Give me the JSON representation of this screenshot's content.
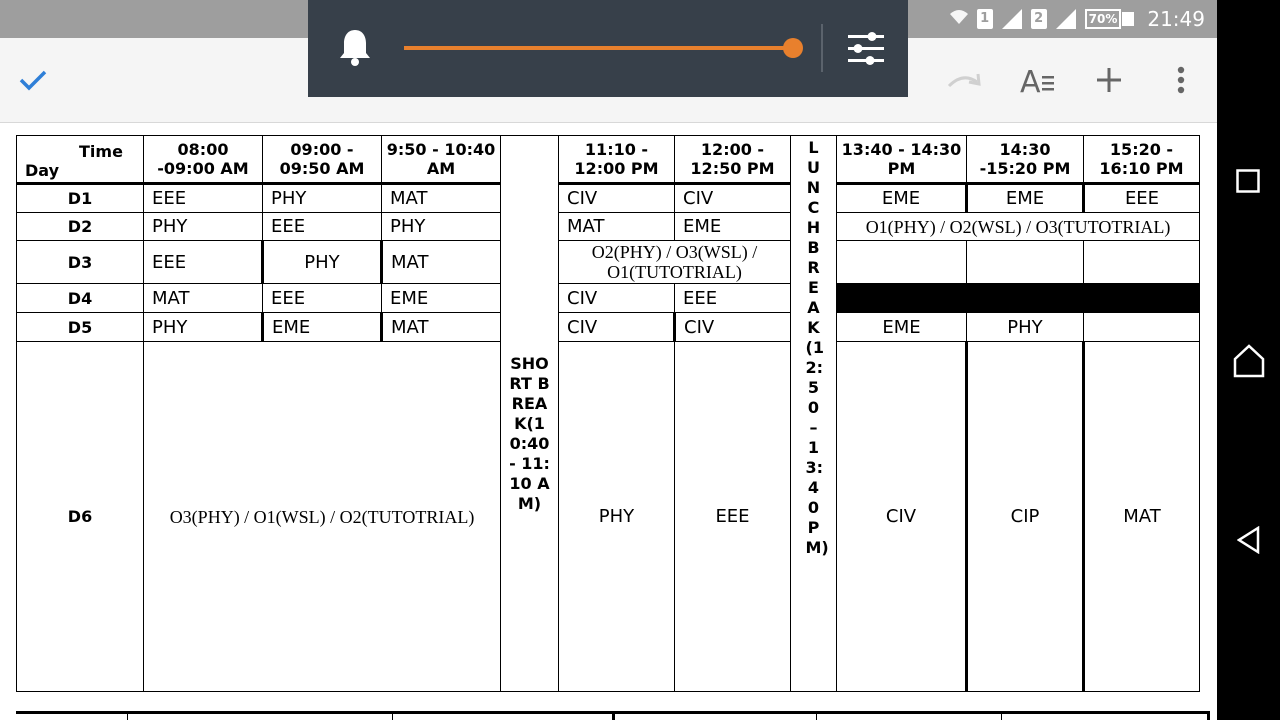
{
  "status_bar": {
    "sim1": "1",
    "sim2": "2",
    "battery": "70%",
    "time": "21:49"
  },
  "toolbar": {
    "check_icon": "check-icon",
    "redo_icon": "redo-icon",
    "text_format_icon": "text-format-icon",
    "add_icon": "add-icon",
    "more_icon": "more-vert-icon"
  },
  "volume": {
    "level_percent": 100,
    "accent_color": "#e8802d"
  },
  "timetable": {
    "corner_time": "Time",
    "corner_day": "Day",
    "headers": {
      "p1": "08:00 -09:00 AM",
      "p2": "09:00 - 09:50 AM",
      "p3": "9:50 - 10:40 AM",
      "p4": "11:10 - 12:00 PM",
      "p5": "12:00 - 12:50 PM",
      "p6": "13:40 - 14:30 PM",
      "p7": "14:30 -15:20 PM",
      "p8": "15:20 - 16:10 PM"
    },
    "short_break": "SHORT BREAK(10:40 - 11:10 AM)",
    "lunch_break": "LUNCH BREAK(12:50 – 13:40PM)",
    "rows": {
      "d1": {
        "day": "D1",
        "c1": "EEE",
        "c2": "PHY",
        "c3": "MAT",
        "c4": "CIV",
        "c5": "CIV",
        "c6": "EME",
        "c7": "EME",
        "c8": "EEE"
      },
      "d2": {
        "day": "D2",
        "c1": "PHY",
        "c2": "EEE",
        "c3": "PHY",
        "c4": "MAT",
        "c5": "EME",
        "c678": "O1(PHY) / O2(WSL) / O3(TUTOTRIAL)"
      },
      "d3": {
        "day": "D3",
        "c1": "EEE",
        "c2": "PHY",
        "c3": "MAT",
        "c45": "O2(PHY) / O3(WSL) / O1(TUTOTRIAL)"
      },
      "d4": {
        "day": "D4",
        "c1": "MAT",
        "c2": "EEE",
        "c3": "EME",
        "c4": "CIV",
        "c5": "EEE"
      },
      "d5": {
        "day": "D5",
        "c1": "PHY",
        "c2": "EME",
        "c3": "MAT",
        "c4": "CIV",
        "c5": "CIV",
        "c6": "EME",
        "c7": "PHY"
      },
      "d6": {
        "day": "D6",
        "c123": "O3(PHY) / O1(WSL) / O2(TUTOTRIAL)",
        "c4": "PHY",
        "c5": "EEE",
        "c6": "CIV",
        "c7": "CIP",
        "c8": "MAT"
      }
    }
  }
}
